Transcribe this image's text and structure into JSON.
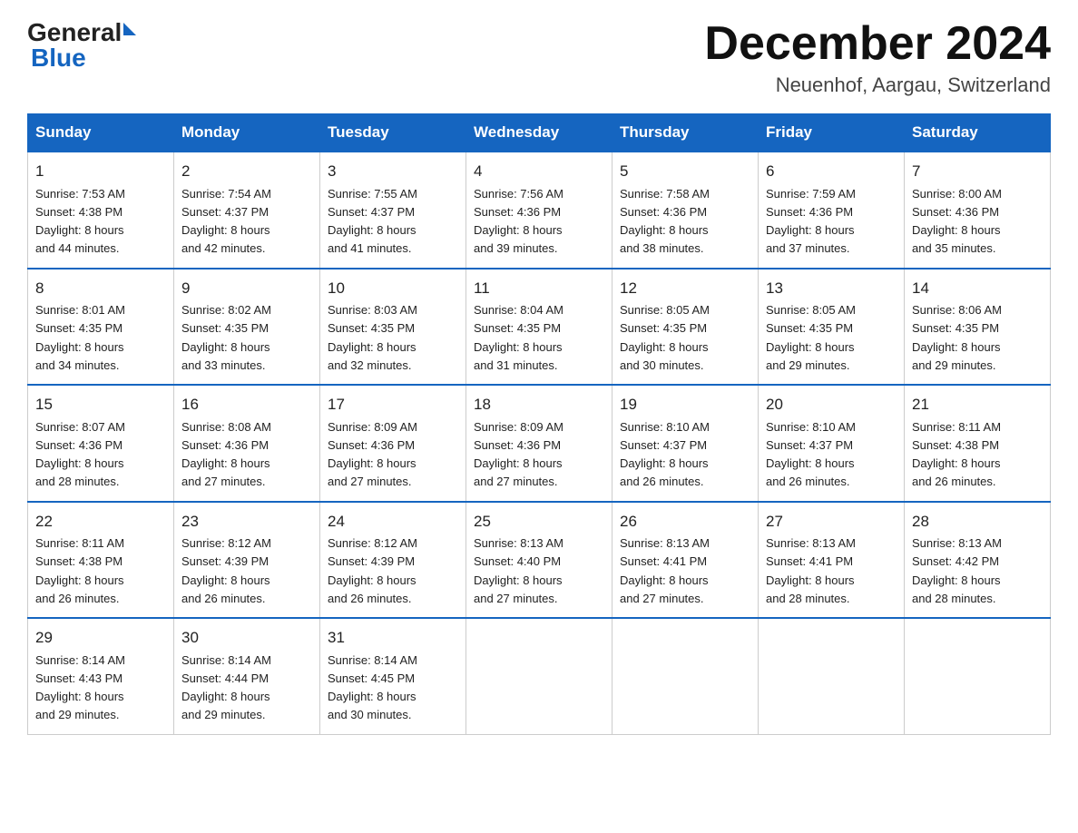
{
  "logo": {
    "general": "General",
    "blue": "Blue"
  },
  "title": "December 2024",
  "subtitle": "Neuenhof, Aargau, Switzerland",
  "days_of_week": [
    "Sunday",
    "Monday",
    "Tuesday",
    "Wednesday",
    "Thursday",
    "Friday",
    "Saturday"
  ],
  "weeks": [
    [
      {
        "day": "1",
        "sunrise": "7:53 AM",
        "sunset": "4:38 PM",
        "daylight": "8 hours and 44 minutes."
      },
      {
        "day": "2",
        "sunrise": "7:54 AM",
        "sunset": "4:37 PM",
        "daylight": "8 hours and 42 minutes."
      },
      {
        "day": "3",
        "sunrise": "7:55 AM",
        "sunset": "4:37 PM",
        "daylight": "8 hours and 41 minutes."
      },
      {
        "day": "4",
        "sunrise": "7:56 AM",
        "sunset": "4:36 PM",
        "daylight": "8 hours and 39 minutes."
      },
      {
        "day": "5",
        "sunrise": "7:58 AM",
        "sunset": "4:36 PM",
        "daylight": "8 hours and 38 minutes."
      },
      {
        "day": "6",
        "sunrise": "7:59 AM",
        "sunset": "4:36 PM",
        "daylight": "8 hours and 37 minutes."
      },
      {
        "day": "7",
        "sunrise": "8:00 AM",
        "sunset": "4:36 PM",
        "daylight": "8 hours and 35 minutes."
      }
    ],
    [
      {
        "day": "8",
        "sunrise": "8:01 AM",
        "sunset": "4:35 PM",
        "daylight": "8 hours and 34 minutes."
      },
      {
        "day": "9",
        "sunrise": "8:02 AM",
        "sunset": "4:35 PM",
        "daylight": "8 hours and 33 minutes."
      },
      {
        "day": "10",
        "sunrise": "8:03 AM",
        "sunset": "4:35 PM",
        "daylight": "8 hours and 32 minutes."
      },
      {
        "day": "11",
        "sunrise": "8:04 AM",
        "sunset": "4:35 PM",
        "daylight": "8 hours and 31 minutes."
      },
      {
        "day": "12",
        "sunrise": "8:05 AM",
        "sunset": "4:35 PM",
        "daylight": "8 hours and 30 minutes."
      },
      {
        "day": "13",
        "sunrise": "8:05 AM",
        "sunset": "4:35 PM",
        "daylight": "8 hours and 29 minutes."
      },
      {
        "day": "14",
        "sunrise": "8:06 AM",
        "sunset": "4:35 PM",
        "daylight": "8 hours and 29 minutes."
      }
    ],
    [
      {
        "day": "15",
        "sunrise": "8:07 AM",
        "sunset": "4:36 PM",
        "daylight": "8 hours and 28 minutes."
      },
      {
        "day": "16",
        "sunrise": "8:08 AM",
        "sunset": "4:36 PM",
        "daylight": "8 hours and 27 minutes."
      },
      {
        "day": "17",
        "sunrise": "8:09 AM",
        "sunset": "4:36 PM",
        "daylight": "8 hours and 27 minutes."
      },
      {
        "day": "18",
        "sunrise": "8:09 AM",
        "sunset": "4:36 PM",
        "daylight": "8 hours and 27 minutes."
      },
      {
        "day": "19",
        "sunrise": "8:10 AM",
        "sunset": "4:37 PM",
        "daylight": "8 hours and 26 minutes."
      },
      {
        "day": "20",
        "sunrise": "8:10 AM",
        "sunset": "4:37 PM",
        "daylight": "8 hours and 26 minutes."
      },
      {
        "day": "21",
        "sunrise": "8:11 AM",
        "sunset": "4:38 PM",
        "daylight": "8 hours and 26 minutes."
      }
    ],
    [
      {
        "day": "22",
        "sunrise": "8:11 AM",
        "sunset": "4:38 PM",
        "daylight": "8 hours and 26 minutes."
      },
      {
        "day": "23",
        "sunrise": "8:12 AM",
        "sunset": "4:39 PM",
        "daylight": "8 hours and 26 minutes."
      },
      {
        "day": "24",
        "sunrise": "8:12 AM",
        "sunset": "4:39 PM",
        "daylight": "8 hours and 26 minutes."
      },
      {
        "day": "25",
        "sunrise": "8:13 AM",
        "sunset": "4:40 PM",
        "daylight": "8 hours and 27 minutes."
      },
      {
        "day": "26",
        "sunrise": "8:13 AM",
        "sunset": "4:41 PM",
        "daylight": "8 hours and 27 minutes."
      },
      {
        "day": "27",
        "sunrise": "8:13 AM",
        "sunset": "4:41 PM",
        "daylight": "8 hours and 28 minutes."
      },
      {
        "day": "28",
        "sunrise": "8:13 AM",
        "sunset": "4:42 PM",
        "daylight": "8 hours and 28 minutes."
      }
    ],
    [
      {
        "day": "29",
        "sunrise": "8:14 AM",
        "sunset": "4:43 PM",
        "daylight": "8 hours and 29 minutes."
      },
      {
        "day": "30",
        "sunrise": "8:14 AM",
        "sunset": "4:44 PM",
        "daylight": "8 hours and 29 minutes."
      },
      {
        "day": "31",
        "sunrise": "8:14 AM",
        "sunset": "4:45 PM",
        "daylight": "8 hours and 30 minutes."
      },
      null,
      null,
      null,
      null
    ]
  ],
  "labels": {
    "sunrise": "Sunrise:",
    "sunset": "Sunset:",
    "daylight": "Daylight:"
  }
}
